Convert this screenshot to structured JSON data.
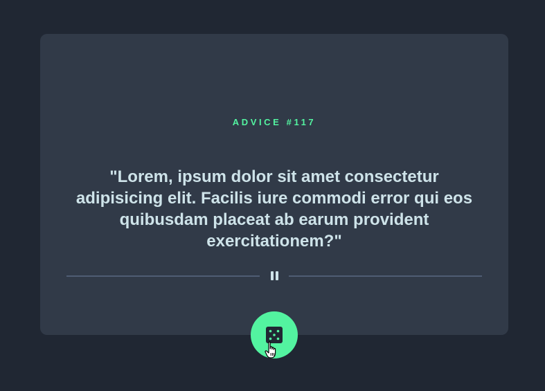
{
  "advice": {
    "id_label": "ADVICE #117",
    "quote": "\"Lorem, ipsum dolor sit amet consectetur adipisicing elit. Facilis iure commodi error qui eos quibusdam placeat ab earum provident exercitationem?\""
  },
  "divider": {
    "icon": "pause-icon"
  },
  "dice_button": {
    "icon": "dice-icon"
  },
  "colors": {
    "background": "#202733",
    "card": "#313a48",
    "accent": "#53f3a0",
    "text": "#cee3e9",
    "divider": "#4f5d74"
  }
}
